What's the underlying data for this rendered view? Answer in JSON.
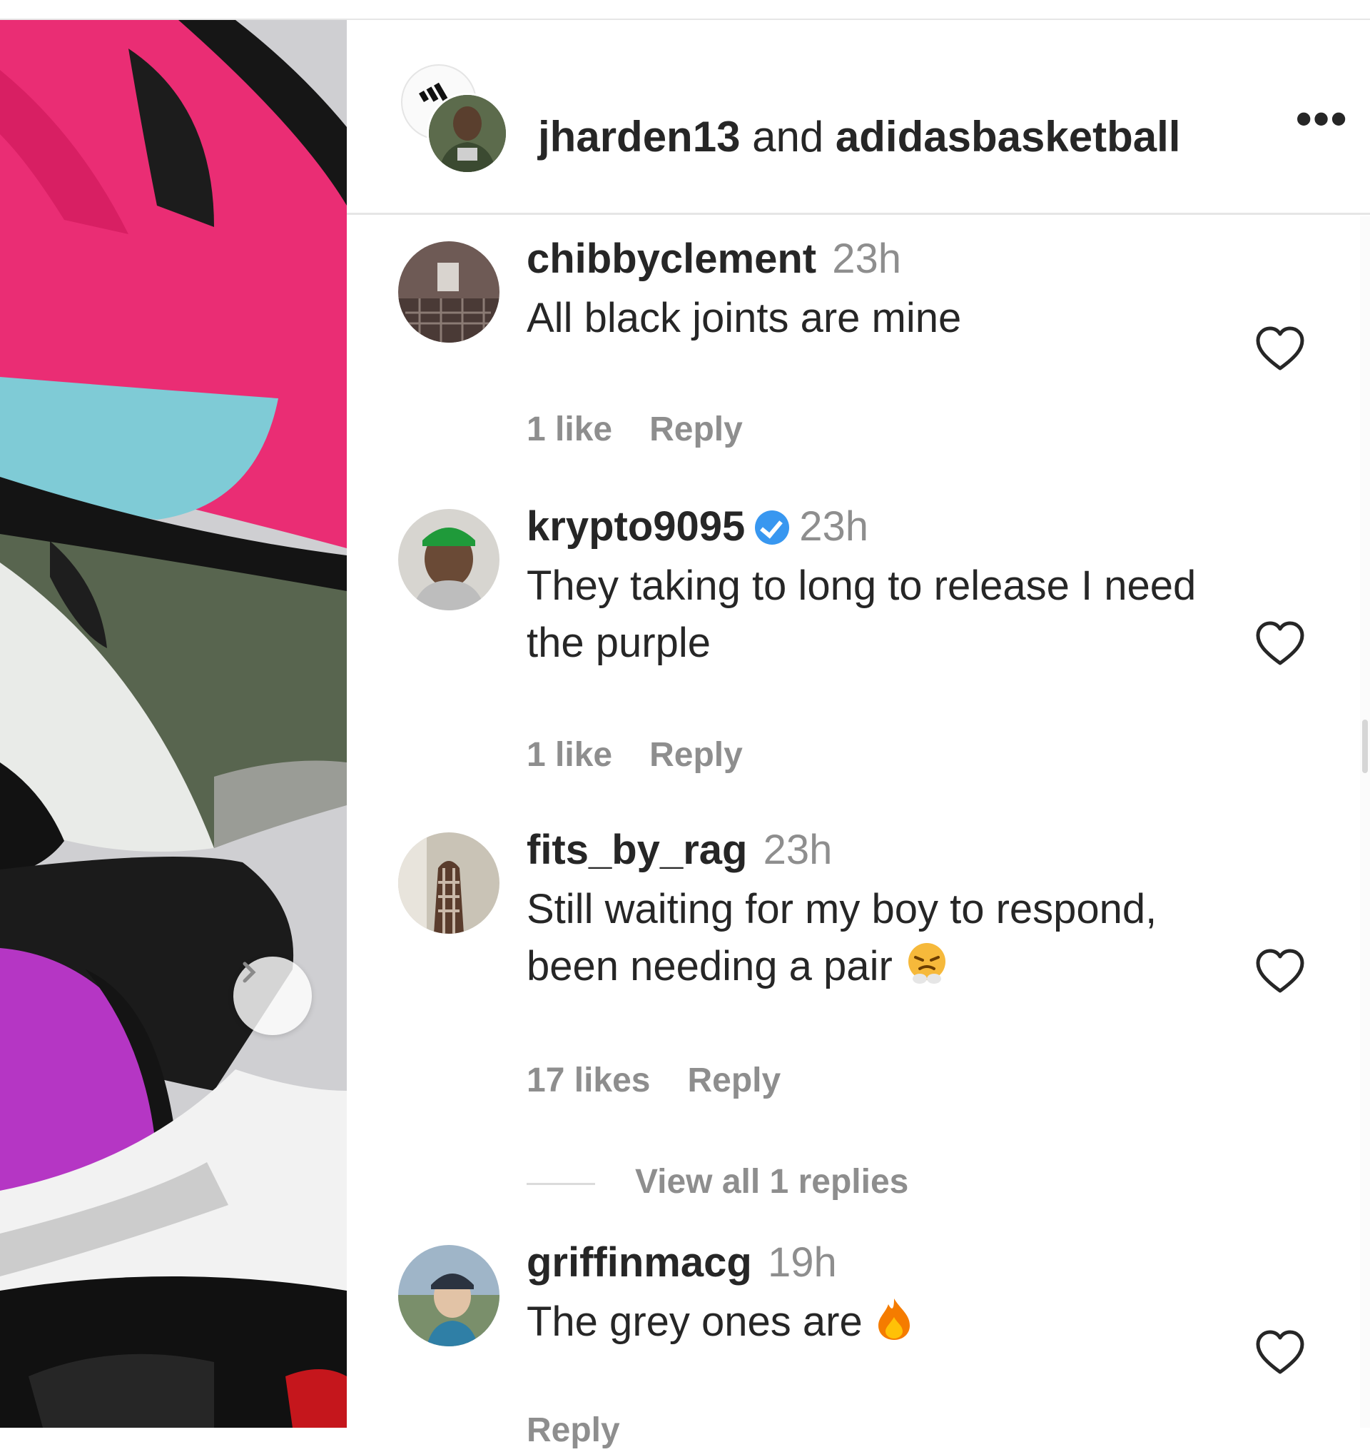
{
  "post": {
    "author_primary": "jharden13",
    "conjunction": "and",
    "author_secondary": "adidasbasketball",
    "more_icon": "more-horizontal-icon"
  },
  "comments": [
    {
      "username": "chibbyclement",
      "verified": false,
      "time": "23h",
      "text": "All black joints are mine",
      "likes": "1 like",
      "reply": "Reply"
    },
    {
      "username": "krypto9095",
      "verified": true,
      "time": "23h",
      "text": "They taking to long to release I need the purple",
      "likes": "1 like",
      "reply": "Reply"
    },
    {
      "username": "fits_by_rag",
      "verified": false,
      "time": "23h",
      "text": "Still waiting for my boy to respond, been needing a pair",
      "emoji": "angry-steam-emoji",
      "likes": "17 likes",
      "reply": "Reply",
      "view_replies": "View all 1 replies"
    },
    {
      "username": "griffinmacg",
      "verified": false,
      "time": "19h",
      "text": "The grey ones are",
      "emoji": "fire-emoji",
      "likes": "",
      "reply": "Reply"
    }
  ],
  "colors": {
    "verified_badge": "#3897f0",
    "secondary_text": "#8e8e8e",
    "primary_text": "#262626"
  }
}
